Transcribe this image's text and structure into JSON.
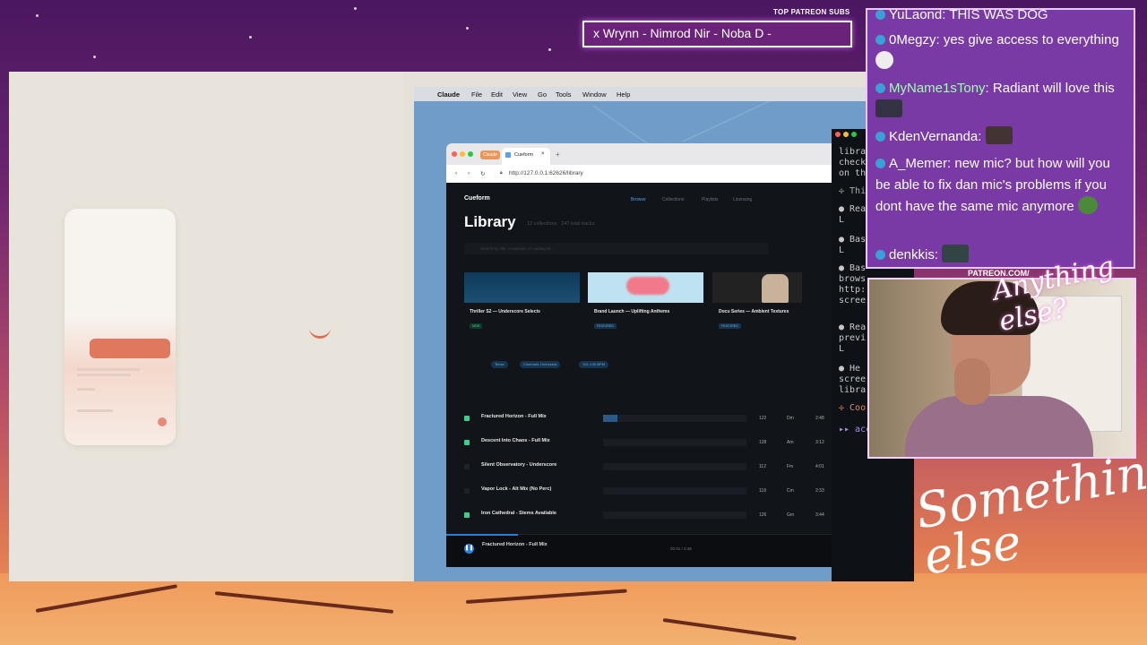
{
  "overlay": {
    "now_playing": "x Wrynn - Nimrod Nir - Noba D -",
    "patreon_label": "TOP PATREON SUBS",
    "patreon_url": "PATREON.COM/",
    "script_top": "Anything else?",
    "script_big": "Something else"
  },
  "chat": {
    "messages": [
      {
        "user": "YuLaond",
        "text": "THIS WAS DOG"
      },
      {
        "user": "0Megzy",
        "text": "yes give access to everything"
      },
      {
        "user": "MyName1sTony",
        "text": "Radiant will love this"
      },
      {
        "user": "KdenVernanda",
        "text": ""
      },
      {
        "user": "A_Memer",
        "text": "new mic? but how will you be able to fix dan mic's problems if you dont have the same mic anymore"
      },
      {
        "user": "denkkis",
        "text": ""
      }
    ],
    "colors": {
      "accent": "#e6c9ff",
      "panel": "#7a3aa6"
    }
  },
  "mac": {
    "menubar": [
      "Claude",
      "File",
      "Edit",
      "View",
      "Go",
      "Tools",
      "Window",
      "Help"
    ]
  },
  "browser": {
    "tab_pinned": "Claude",
    "tab_active": "Cueform",
    "url": "http://127.0.0.1:62626/library"
  },
  "app": {
    "brand": "Cueform",
    "nav": [
      "Browse",
      "Collections",
      "Playlists",
      "Licensing"
    ],
    "title": "Library",
    "subtitle": "12 collections · 247 total tracks",
    "search_placeholder": "Search by title, composer, or catalog ID...",
    "cards": [
      {
        "title": "Thriller S2 — Underscore Selects",
        "badge": "NEW"
      },
      {
        "title": "Brand Launch — Uplifting Anthems",
        "badge": "FEATURED"
      },
      {
        "title": "Docu Series — Ambient Textures",
        "badge": "FEATURED"
      }
    ],
    "chips": [
      "Tense",
      "Cinematic Orchestral",
      "110–130 BPM"
    ],
    "tracks": [
      {
        "title": "Fractured Horizon - Full Mix",
        "bpm": "122",
        "key": "Dm",
        "dur": "2:48",
        "checked": true
      },
      {
        "title": "Descent Into Chaos - Full Mix",
        "bpm": "128",
        "key": "Am",
        "dur": "3:12",
        "checked": true
      },
      {
        "title": "Silent Observatory - Underscore",
        "bpm": "112",
        "key": "Fm",
        "dur": "4:01",
        "checked": false
      },
      {
        "title": "Vapor Lock - Alt Mix (No Perc)",
        "bpm": "118",
        "key": "Cm",
        "dur": "2:33",
        "checked": false
      },
      {
        "title": "Iron Cathedral - Stems Available",
        "bpm": "126",
        "key": "Gm",
        "dur": "3:44",
        "checked": true
      }
    ],
    "player": {
      "title": "Fractured Horizon - Full Mix",
      "time": "00:31 / 2:48"
    }
  },
  "terminal": {
    "lines": [
      "libra",
      "check",
      "on th",
      "✢ Thi",
      "● Rea",
      "  L  ",
      "● Bas",
      "  L  ",
      "● Bas",
      "brows",
      "http:",
      "scree",
      "● Rea",
      "previ",
      "  L  ",
      "● He",
      "scree",
      "libra",
      "✢ Coo"
    ],
    "accept": "▸▸ accept edit"
  }
}
